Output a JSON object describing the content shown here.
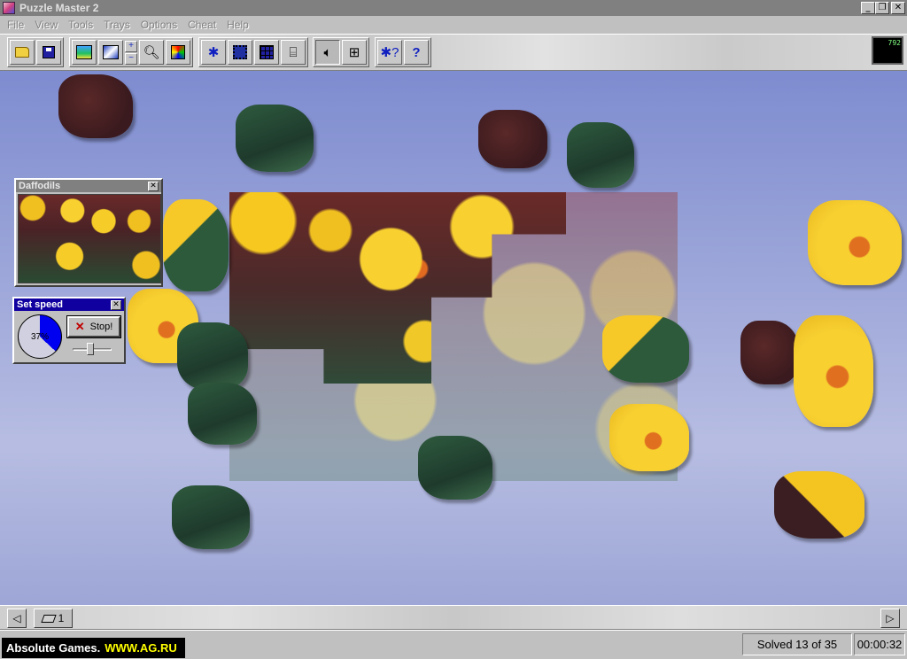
{
  "window": {
    "title": "Puzzle Master 2",
    "buttons": [
      "_",
      "❐",
      "✕"
    ]
  },
  "menu": [
    "File",
    "View",
    "Tools",
    "Trays",
    "Options",
    "Cheat",
    "Help"
  ],
  "toolbar": {
    "groups": [
      [
        "folder-open-icon",
        "save-disk-icon"
      ],
      [
        "picture-icon",
        "image-icon",
        "zoom-in-icon",
        "zoom-out-icon",
        "magnify-icon",
        "colors-icon"
      ],
      [
        "puzzle-piece-icon",
        "edge-frame-icon",
        "grid-icon",
        "tray-icon"
      ],
      [
        "speaker-icon",
        "picture-frame-icon"
      ],
      [
        "puzzle-help-icon",
        "help-icon"
      ]
    ],
    "preview_counter": "792"
  },
  "thumbnail_window": {
    "title": "Daffodils",
    "close": "✕"
  },
  "speed_window": {
    "title": "Set speed",
    "close": "✕",
    "percent_label": "37%",
    "percent_value": 0.37,
    "stop_label": "Stop!",
    "slider_value": 0.45,
    "pie_color": "#0000f0"
  },
  "tray": {
    "left_arrow": "◁",
    "right_arrow": "▷",
    "tray_count": "1"
  },
  "status": {
    "brand_name": "Absolute Games.",
    "brand_url": "WWW.AG.RU",
    "solved": "Solved 13 of 35",
    "timer": "00:00:32"
  },
  "colors": {
    "title_bar": "#808080",
    "active_title": "#1000a0",
    "play_area": "#9aa4d8"
  }
}
